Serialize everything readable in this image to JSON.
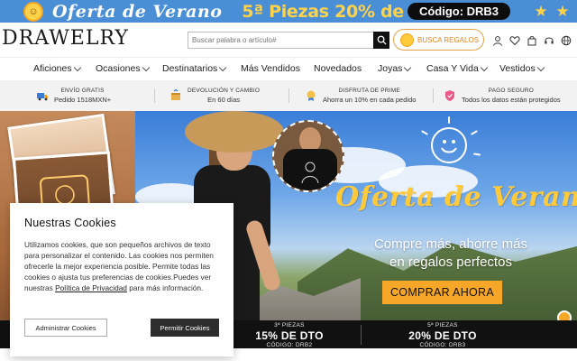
{
  "promo_bar": {
    "title": "Oferta de Verano",
    "offer": "5ª Piezas 20% de dto",
    "code": "Código: DRB3"
  },
  "header": {
    "logo": "DRAWELRY",
    "search_placeholder": "Buscar palabra o artículo#",
    "gifts_label": "BUSCA REGALOS"
  },
  "nav": {
    "items": [
      {
        "label": "Aficiones",
        "has_dropdown": true
      },
      {
        "label": "Ocasiones",
        "has_dropdown": true
      },
      {
        "label": "Destinatarios",
        "has_dropdown": true
      },
      {
        "label": "Más Vendidos",
        "has_dropdown": false
      },
      {
        "label": "Novedados",
        "has_dropdown": false
      },
      {
        "label": "Joyas",
        "has_dropdown": true
      },
      {
        "label": "Casa Y Vida",
        "has_dropdown": true
      },
      {
        "label": "Vestidos",
        "has_dropdown": true
      }
    ]
  },
  "benefits": [
    {
      "title": "ENVÍO GRATIS",
      "subtitle": "Pedido 1518MXN+",
      "icon": "truck-icon"
    },
    {
      "title": "DEVOLUCIÓN Y CAMBIO",
      "subtitle": "En 60 días",
      "icon": "return-box-icon"
    },
    {
      "title": "DISFRUTA DE PRIME",
      "subtitle": "Ahorra un 10% en cada pedido",
      "icon": "prime-badge-icon"
    },
    {
      "title": "PAGO SEGURO",
      "subtitle": "Todos los datos están protegidos",
      "icon": "secure-shield-icon"
    }
  ],
  "hero": {
    "title": "Oferta de Verano",
    "subtitle_line1": "Compre más, ahorre más",
    "subtitle_line2": "en regalos perfectos",
    "cta": "COMPRAR AHORA"
  },
  "deals": [
    {
      "tag": "3ª PIEZAS",
      "main": "15% DE DTO",
      "code": "CÓDIGO: DRB2"
    },
    {
      "tag": "5ª PIEZAS",
      "main": "20% DE DTO",
      "code": "CÓDIGO: DRB3"
    }
  ],
  "cookie": {
    "title": "Nuestras Cookies",
    "body": "Utilizamos cookies, que son pequeños archivos de texto para personalizar el contenido. Las cookies nos permiten ofrecerle la mejor experiencia posible. Permite todas las cookies o ajusta tus preferencias de cookies.Puedes ver nuestras ",
    "link": "Política de Privacidad",
    "body_end": " para más información.",
    "manage_label": "Administrar Cookies",
    "allow_label": "Permitir Cookies"
  },
  "colors": {
    "promo_bg": "#4a8fd6",
    "accent_orange": "#f7a728",
    "promo_yellow": "#ffd24a",
    "dark": "#111111"
  }
}
